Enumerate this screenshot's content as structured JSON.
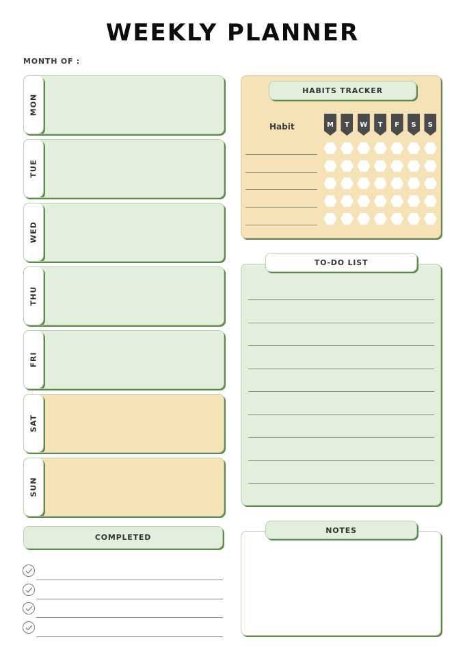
{
  "title": "WEEKLY PLANNER",
  "month_label": "MONTH OF :",
  "days": [
    {
      "label": "MON",
      "color": "green"
    },
    {
      "label": "TUE",
      "color": "green"
    },
    {
      "label": "WED",
      "color": "green"
    },
    {
      "label": "THU",
      "color": "green"
    },
    {
      "label": "FRI",
      "color": "green"
    },
    {
      "label": "SAT",
      "color": "tan"
    },
    {
      "label": "SUN",
      "color": "tan"
    }
  ],
  "completed": {
    "title": "COMPLETED",
    "rows": 4
  },
  "habits": {
    "title": "HABITS TRACKER",
    "habit_label": "Habit",
    "weekdays": [
      "M",
      "T",
      "W",
      "T",
      "F",
      "S",
      "S"
    ],
    "rows": 5
  },
  "todo": {
    "title": "TO-DO LIST",
    "lines": 9
  },
  "notes": {
    "title": "NOTES"
  },
  "colors": {
    "green": "#e2efdc",
    "tan": "#f5e2b6",
    "border_shadow": "#5f8a4d",
    "flag": "#4a4a4a"
  }
}
